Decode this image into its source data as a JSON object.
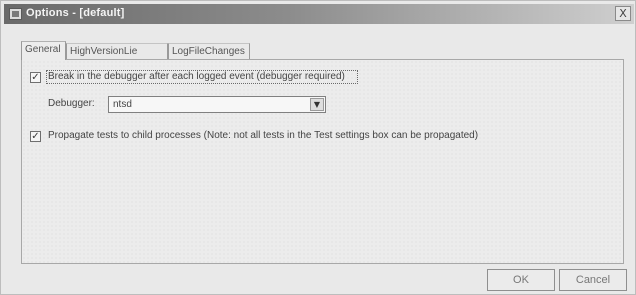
{
  "window": {
    "title": "Options - [default]",
    "close_glyph": "X"
  },
  "tabs": [
    {
      "label": "General",
      "active": true
    },
    {
      "label": "HighVersionLie",
      "active": false
    },
    {
      "label": "LogFileChanges",
      "active": false
    }
  ],
  "general": {
    "break_in_debugger": {
      "checked": true,
      "check_glyph": "✓",
      "label": "Break in the debugger after each logged event (debugger required)"
    },
    "debugger": {
      "label": "Debugger:",
      "value": "ntsd",
      "arrow_glyph": "▼"
    },
    "propagate_tests": {
      "checked": true,
      "check_glyph": "✓",
      "label": "Propagate tests to child processes (Note: not all tests in the Test settings box can be propagated)"
    }
  },
  "buttons": {
    "ok_label": "OK",
    "cancel_label": "Cancel"
  },
  "colors": {
    "title_gradient_start": "#6a6a6a",
    "title_gradient_end": "#cfcfcf",
    "dialog_background": "#e9e9e9"
  }
}
